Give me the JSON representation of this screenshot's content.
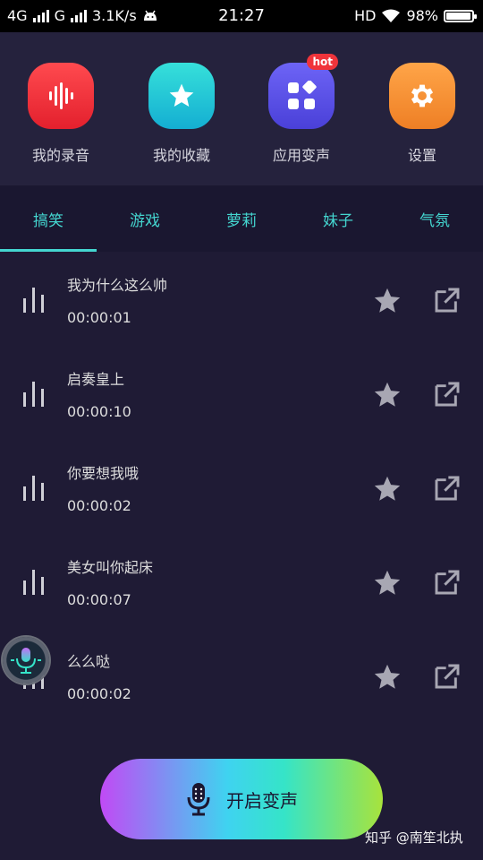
{
  "status_bar": {
    "network_left": "4G",
    "carrier_g": "G",
    "speed": "3.1K/s",
    "time": "21:27",
    "hd": "HD",
    "battery_percent": "98%",
    "battery_level": 0.98,
    "icons": [
      "signal-icon",
      "android-icon",
      "wifi-icon",
      "battery-icon"
    ]
  },
  "shortcuts": [
    {
      "label": "我的录音",
      "icon": "waveform-icon",
      "color": "#ef2f3a"
    },
    {
      "label": "我的收藏",
      "icon": "star-icon",
      "color": "#1ec6d6"
    },
    {
      "label": "应用变声",
      "icon": "apps-icon",
      "color": "#5b54e8",
      "badge": "hot"
    },
    {
      "label": "设置",
      "icon": "gear-icon",
      "color": "#f49736"
    }
  ],
  "tabs": [
    {
      "label": "搞笑",
      "active": true
    },
    {
      "label": "游戏"
    },
    {
      "label": "萝莉"
    },
    {
      "label": "妹子"
    },
    {
      "label": "气氛"
    }
  ],
  "items": [
    {
      "title": "我为什么这么帅",
      "duration": "00:00:01"
    },
    {
      "title": "启奏皇上",
      "duration": "00:00:10"
    },
    {
      "title": "你要想我哦",
      "duration": "00:00:02"
    },
    {
      "title": "美女叫你起床",
      "duration": "00:00:07"
    },
    {
      "title": "么么哒",
      "duration": "00:00:02"
    }
  ],
  "cta": {
    "label": "开启变声",
    "icon": "microphone-icon"
  },
  "watermark": "知乎 @南笙北执",
  "colors": {
    "accent": "#44d6d0",
    "background": "#1f1b35",
    "header_bg": "#25223d",
    "tab_bg": "#1a1730"
  }
}
